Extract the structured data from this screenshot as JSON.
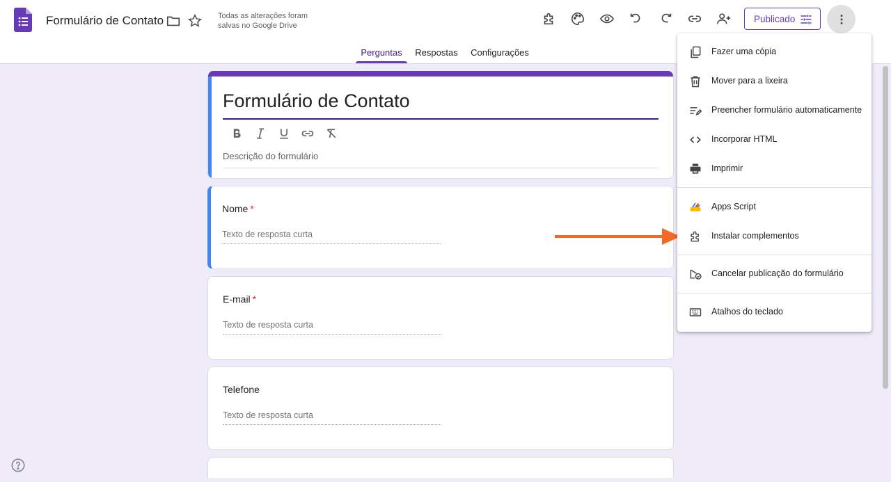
{
  "header": {
    "doc_title": "Formulário de Contato",
    "save_status": "Todas as alterações foram salvas no Google Drive",
    "publish_label": "Publicado",
    "icons": [
      "forms-logo-icon",
      "folder-icon",
      "star-icon",
      "addons-icon",
      "palette-icon",
      "preview-eye-icon",
      "undo-icon",
      "redo-icon",
      "link-icon",
      "add-collaborator-icon",
      "tune-icon",
      "more-vert-icon"
    ],
    "accent_color": "#673ab7"
  },
  "tabs": [
    {
      "label": "Perguntas",
      "active": true
    },
    {
      "label": "Respostas",
      "active": false
    },
    {
      "label": "Configurações",
      "active": false
    }
  ],
  "form": {
    "title": "Formulário de Contato",
    "description_placeholder": "Descrição do formulário",
    "format_tools": [
      "bold-icon",
      "italic-icon",
      "underline-icon",
      "link-icon",
      "clear-format-icon"
    ],
    "questions": [
      {
        "label": "Nome",
        "required": true,
        "answer_placeholder": "Texto de resposta curta"
      },
      {
        "label": "E-mail",
        "required": true,
        "answer_placeholder": "Texto de resposta curta"
      },
      {
        "label": "Telefone",
        "required": false,
        "answer_placeholder": "Texto de resposta curta"
      }
    ]
  },
  "menu": {
    "items": [
      {
        "label": "Fazer uma cópia",
        "icon": "copy-icon"
      },
      {
        "label": "Mover para a lixeira",
        "icon": "trash-icon"
      },
      {
        "label": "Preencher formulário automaticamente",
        "icon": "autofill-icon"
      },
      {
        "label": "Incorporar HTML",
        "icon": "code-icon"
      },
      {
        "label": "Imprimir",
        "icon": "print-icon"
      },
      {
        "label": "Apps Script",
        "icon": "apps-script-icon"
      },
      {
        "label": "Instalar complementos",
        "icon": "addons-icon"
      },
      {
        "label": "Cancelar publicação do formulário",
        "icon": "unpublish-icon"
      },
      {
        "label": "Atalhos do teclado",
        "icon": "keyboard-icon"
      }
    ],
    "highlight_arrow_color": "#f26b24"
  },
  "required_marker": "*"
}
